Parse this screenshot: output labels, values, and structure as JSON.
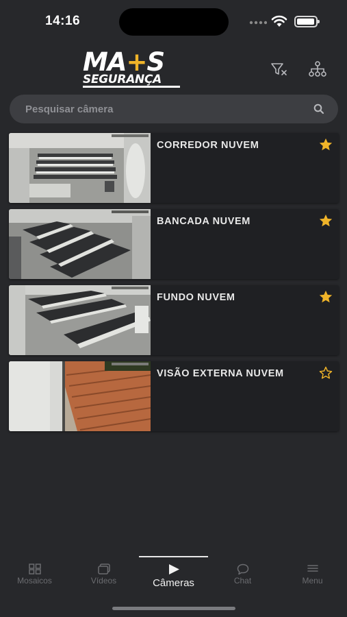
{
  "status": {
    "time": "14:16"
  },
  "header": {
    "logo_top_left": "MA",
    "logo_plus": "+",
    "logo_top_right": "S",
    "logo_bottom": "SEGURANÇA",
    "filter_icon": "filter-clear-icon",
    "tree_icon": "hierarchy-icon"
  },
  "search": {
    "placeholder": "Pesquisar câmera",
    "value": ""
  },
  "cameras": [
    {
      "name": "CORREDOR NUVEM",
      "favorite": true
    },
    {
      "name": "BANCADA NUVEM",
      "favorite": true
    },
    {
      "name": "FUNDO NUVEM",
      "favorite": true
    },
    {
      "name": "VISÃO EXTERNA NUVEM",
      "favorite": false
    }
  ],
  "tabs": [
    {
      "label": "Mosaicos",
      "icon": "grid-icon",
      "active": false
    },
    {
      "label": "Vídeos",
      "icon": "videos-icon",
      "active": false
    },
    {
      "label": "Câmeras",
      "icon": "play-icon",
      "active": true
    },
    {
      "label": "Chat",
      "icon": "chat-icon",
      "active": false
    },
    {
      "label": "Menu",
      "icon": "menu-icon",
      "active": false
    }
  ],
  "colors": {
    "accent": "#f0b429",
    "background": "#27282b",
    "card": "#1f2023"
  }
}
